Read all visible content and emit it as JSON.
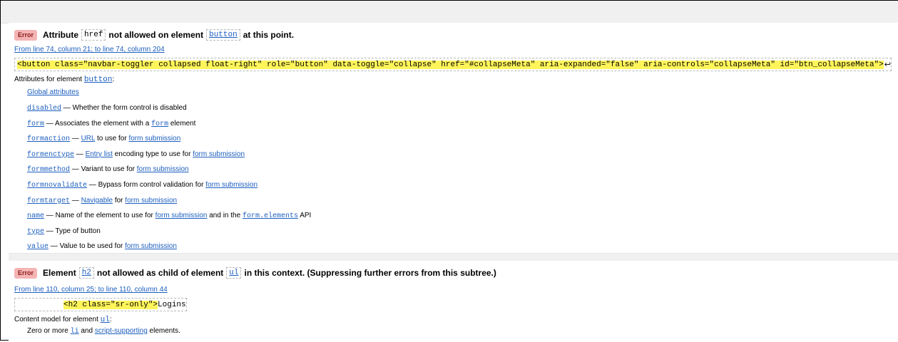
{
  "error1": {
    "badge": "Error",
    "pre": "Attribute",
    "attr_code": "href",
    "mid": "not allowed on element",
    "element_code": "button",
    "post": "at this point.",
    "location": "From line 74, column 21; to line 74, column 204",
    "extract_code": "<button class=\"navbar-toggler collapsed float-right\" role=\"button\" data-toggle=\"collapse\" href=\"#collapseMeta\" aria-expanded=\"false\" aria-controls=\"collapseMeta\" id=\"btn_collapseMeta\">",
    "return_symbol": "↩",
    "attrs_title": "Attributes for element",
    "attrs_element": "button",
    "attrs_colon": ":",
    "global_attributes": "Global attributes",
    "items": [
      {
        "code": "disabled",
        "segs": [
          {
            "t": " — Whether the form control is disabled",
            "link": false
          }
        ]
      },
      {
        "code": "form",
        "segs": [
          {
            "t": " — Associates the element with a ",
            "link": false
          },
          {
            "t": "form",
            "link": true,
            "code": true
          },
          {
            "t": " element",
            "link": false
          }
        ]
      },
      {
        "code": "formaction",
        "segs": [
          {
            "t": " — ",
            "link": false
          },
          {
            "t": "URL",
            "link": true
          },
          {
            "t": " to use for ",
            "link": false
          },
          {
            "t": "form submission",
            "link": true
          }
        ]
      },
      {
        "code": "formenctype",
        "segs": [
          {
            "t": " — ",
            "link": false
          },
          {
            "t": "Entry list",
            "link": true
          },
          {
            "t": " encoding type to use for ",
            "link": false
          },
          {
            "t": "form submission",
            "link": true
          }
        ]
      },
      {
        "code": "formmethod",
        "segs": [
          {
            "t": " — Variant to use for ",
            "link": false
          },
          {
            "t": "form submission",
            "link": true
          }
        ]
      },
      {
        "code": "formnovalidate",
        "segs": [
          {
            "t": " — Bypass form control validation for ",
            "link": false
          },
          {
            "t": "form submission",
            "link": true
          }
        ]
      },
      {
        "code": "formtarget",
        "segs": [
          {
            "t": " — ",
            "link": false
          },
          {
            "t": "Navigable",
            "link": true
          },
          {
            "t": " for ",
            "link": false
          },
          {
            "t": "form submission",
            "link": true
          }
        ]
      },
      {
        "code": "name",
        "segs": [
          {
            "t": " — Name of the element to use for ",
            "link": false
          },
          {
            "t": "form submission",
            "link": true
          },
          {
            "t": " and in the ",
            "link": false
          },
          {
            "t": "form.elements",
            "link": true,
            "code": true
          },
          {
            "t": " API",
            "link": false
          }
        ]
      },
      {
        "code": "type",
        "segs": [
          {
            "t": " — Type of button",
            "link": false
          }
        ]
      },
      {
        "code": "value",
        "segs": [
          {
            "t": " — Value to be used for ",
            "link": false
          },
          {
            "t": "form submission",
            "link": true
          }
        ]
      }
    ]
  },
  "error2": {
    "badge": "Error",
    "pre": "Element",
    "elem_code": "h2",
    "mid": "not allowed as child of element",
    "parent_code": "ul",
    "post": "in this context. (Suppressing further errors from this subtree.)",
    "location": "From line 110, column 25; to line 110, column 44",
    "extract_code": "<h2 class=\"sr-only\">",
    "extract_tail": "Logins",
    "model_title": "Content model for element",
    "model_element": "ul",
    "model_colon": ":",
    "model_pre": "Zero or more ",
    "model_li": "li",
    "model_and": " and ",
    "model_link": "script-supporting",
    "model_post": " elements."
  },
  "colors": {
    "badge_bg": "#f4b4b4",
    "highlight": "#fff55a",
    "link": "#1d5fbf"
  }
}
